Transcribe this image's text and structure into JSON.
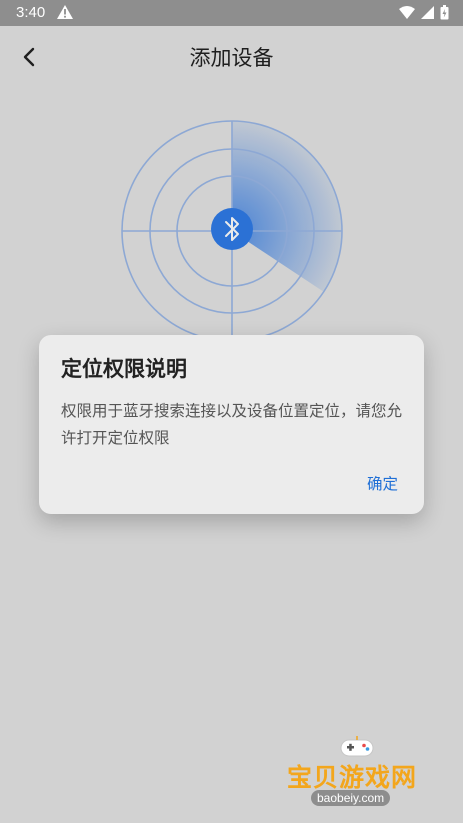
{
  "status": {
    "time": "3:40",
    "warning_icon": "warning-icon",
    "colors": {
      "bar": "#8e8e8e"
    }
  },
  "header": {
    "title": "添加设备"
  },
  "radar": {
    "center_icon": "bluetooth-icon",
    "accent": "#2f7be8"
  },
  "dialog": {
    "title": "定位权限说明",
    "body": "权限用于蓝牙搜索连接以及设备位置定位，请您允许打开定位权限",
    "confirm": "确定"
  },
  "watermark": {
    "title": "宝贝游戏网",
    "subtitle": "baobeiy.com"
  }
}
